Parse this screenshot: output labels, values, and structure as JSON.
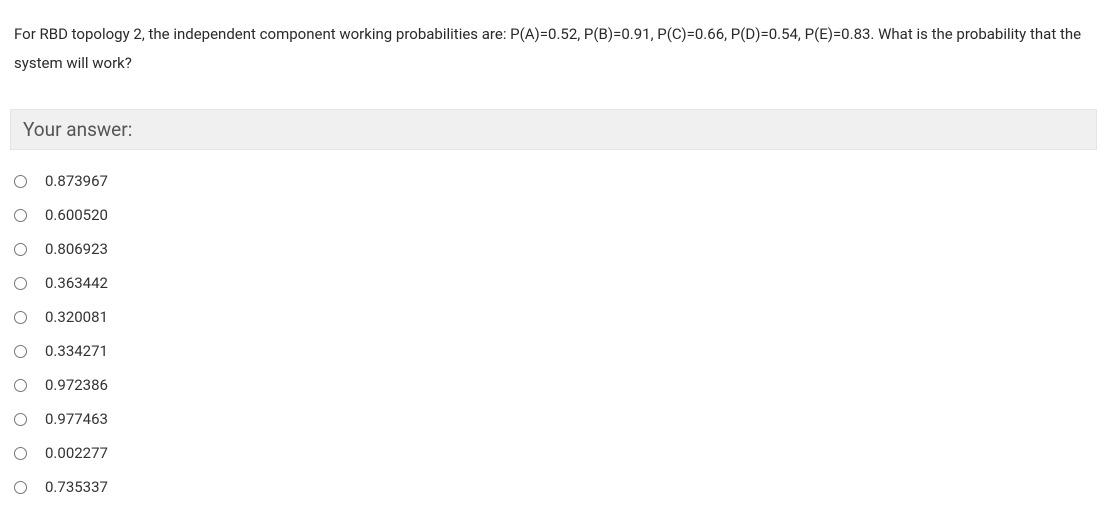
{
  "question": "For RBD topology 2, the independent component working probabilities are: P(A)=0.52, P(B)=0.91, P(C)=0.66, P(D)=0.54, P(E)=0.83. What is the probability that the system will work?",
  "answer_header": "Your answer:",
  "options": [
    {
      "label": "0.873967"
    },
    {
      "label": "0.600520"
    },
    {
      "label": "0.806923"
    },
    {
      "label": "0.363442"
    },
    {
      "label": "0.320081"
    },
    {
      "label": "0.334271"
    },
    {
      "label": "0.972386"
    },
    {
      "label": "0.977463"
    },
    {
      "label": "0.002277"
    },
    {
      "label": "0.735337"
    }
  ]
}
